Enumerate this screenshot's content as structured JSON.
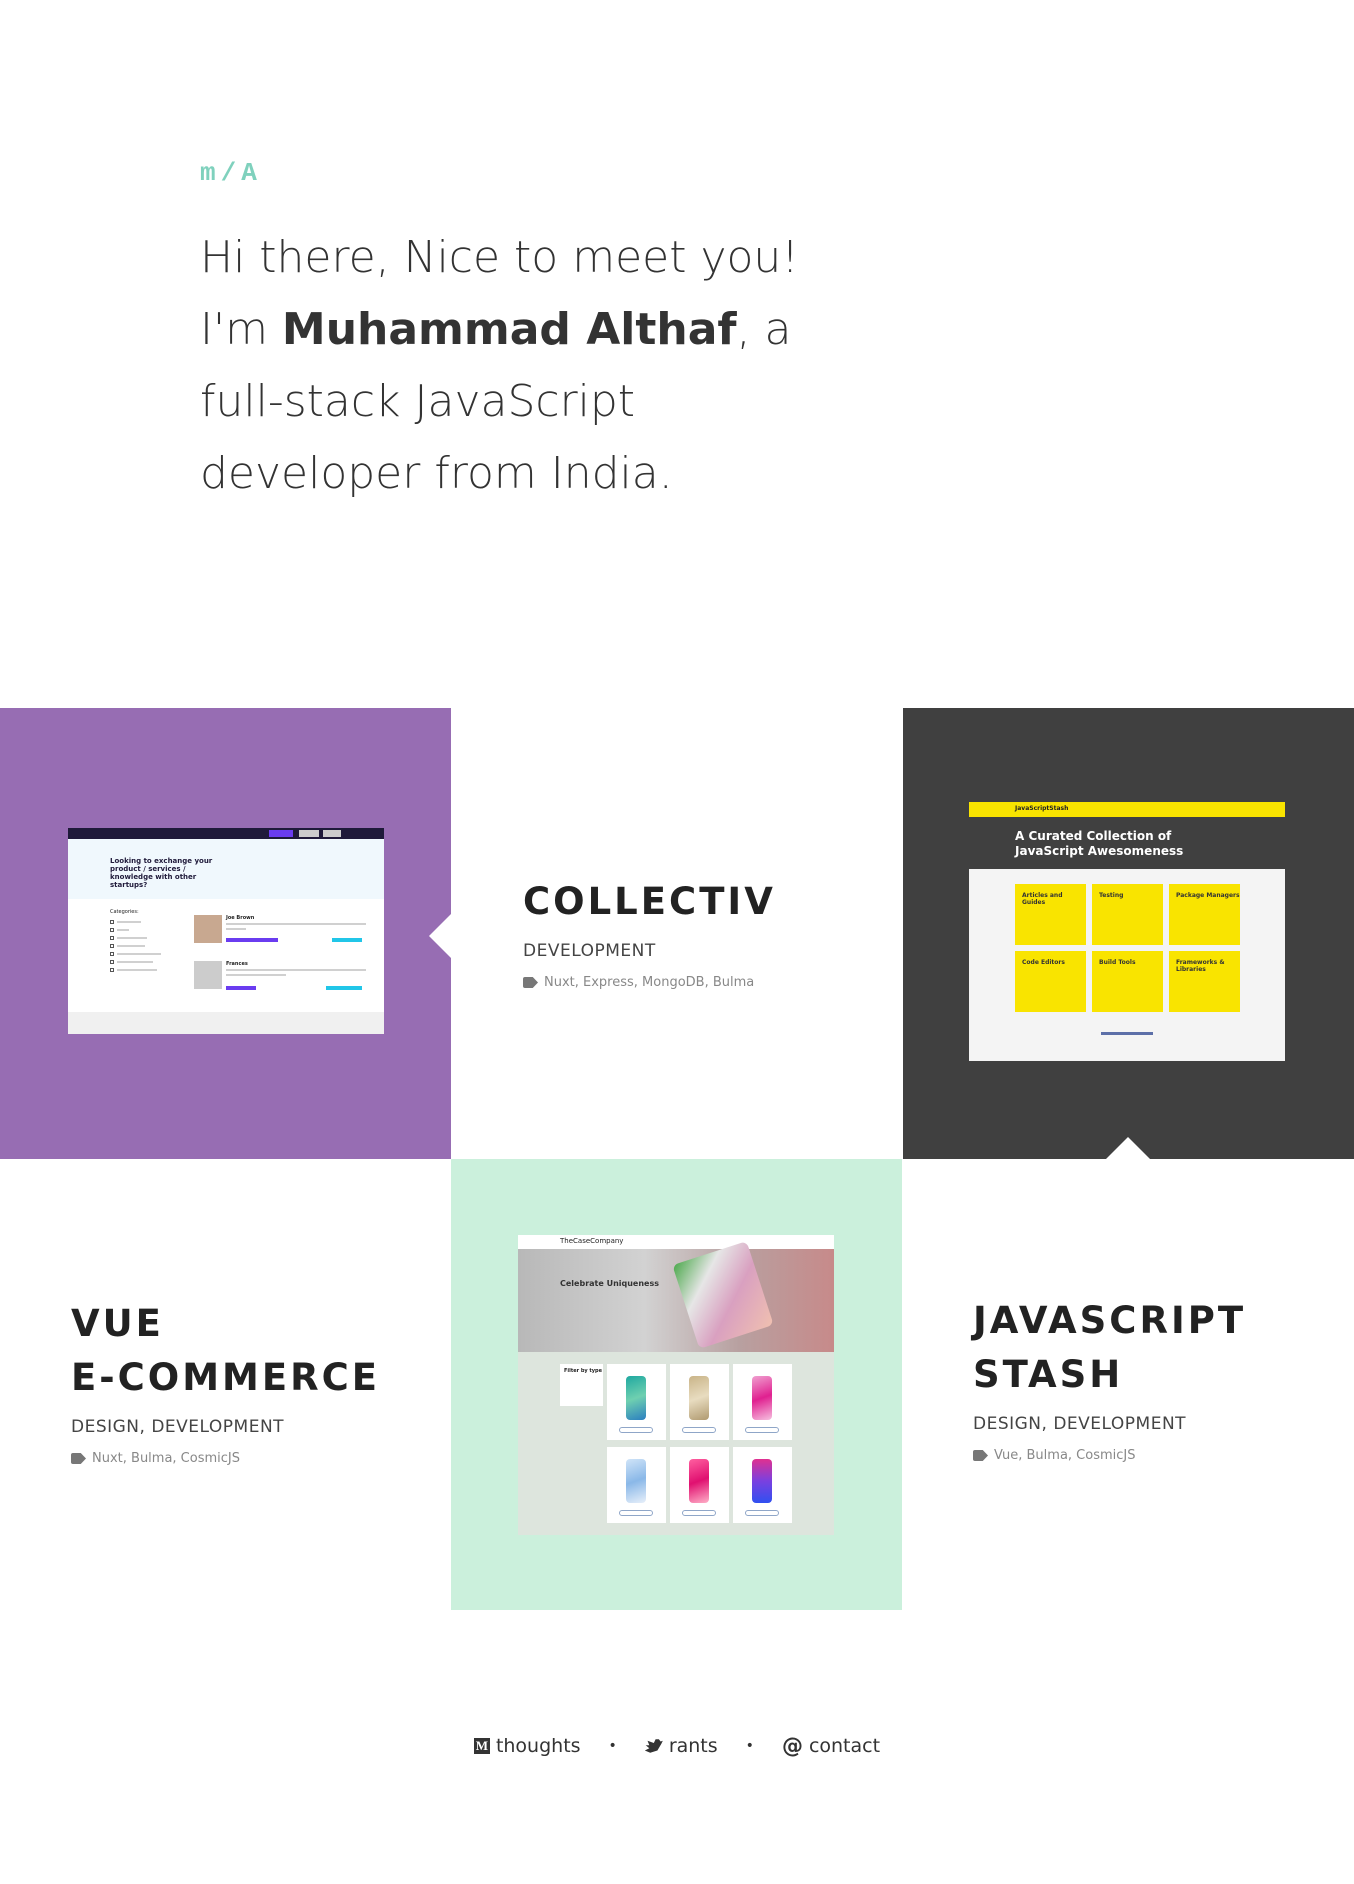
{
  "header": {
    "logo": "m/A",
    "intro_line1": "Hi there, Nice to meet you!",
    "intro_prefix": "I'm ",
    "intro_name": "Muhammad Althaf",
    "intro_suffix": ", a",
    "intro_line3": "full-stack JavaScript",
    "intro_line4": "developer from India."
  },
  "projects": [
    {
      "title": "COLLECTIV",
      "roles": "DEVELOPMENT",
      "tags": "Nuxt, Express, MongoDB, Bulma",
      "bg_color": "#976db3",
      "screenshot": {
        "hero_text": "Looking to exchange your product / services / knowledge with other startups?",
        "categories_label": "Categories:",
        "person1": "Joe Brown",
        "person2": "Frances"
      }
    },
    {
      "title": "JAVASCRIPT STASH",
      "title_line1": "JAVASCRIPT",
      "title_line2": "STASH",
      "roles": "DESIGN, DEVELOPMENT",
      "tags": "Vue, Bulma, CosmicJS",
      "bg_color": "#404040",
      "screenshot": {
        "brand": "JavaScriptStash",
        "hero_text": "A Curated Collection of JavaScript Awesomeness",
        "cards": [
          "Articles and Guides",
          "Testing",
          "Package Managers",
          "Code Editors",
          "Build Tools",
          "Frameworks & Libraries"
        ]
      }
    },
    {
      "title": "VUE E-COMMERCE",
      "title_line1": "VUE",
      "title_line2": "E-COMMERCE",
      "roles": "DESIGN, DEVELOPMENT",
      "tags": "Nuxt, Bulma, CosmicJS",
      "bg_color": "#cbf0dc",
      "screenshot": {
        "brand": "TheCaseCompany",
        "hero_text": "Celebrate Uniqueness",
        "filter_label": "Filter by type"
      }
    }
  ],
  "footer": {
    "links": [
      {
        "label": "thoughts",
        "icon": "medium-icon"
      },
      {
        "label": "rants",
        "icon": "twitter-icon"
      },
      {
        "label": "contact",
        "icon": "at-icon"
      }
    ],
    "separator": "•"
  }
}
